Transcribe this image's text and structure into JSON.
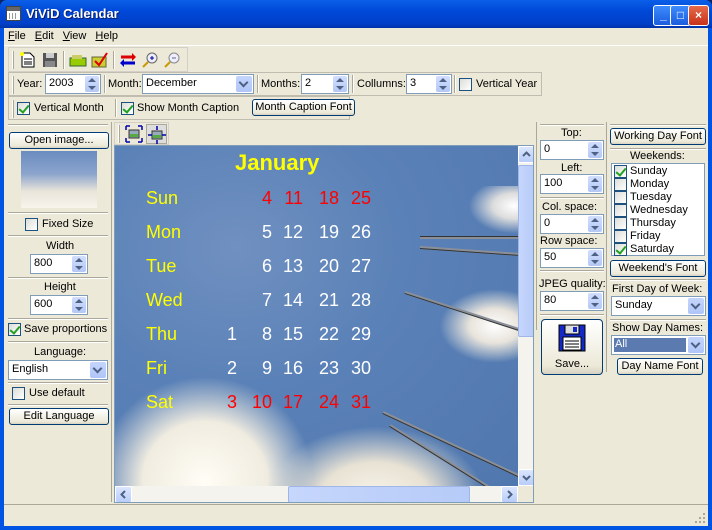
{
  "window": {
    "title": "ViViD Calendar",
    "minimize_label": "_",
    "maximize_label": "□",
    "close_label": "×"
  },
  "menu": [
    {
      "label": "File",
      "accel": "F",
      "rest": "ile"
    },
    {
      "label": "Edit",
      "accel": "E",
      "rest": "dit"
    },
    {
      "label": "View",
      "accel": "V",
      "rest": "iew"
    },
    {
      "label": "Help",
      "accel": "H",
      "rest": "elp"
    }
  ],
  "toolbar": {
    "icons": [
      "new-document-icon",
      "save-icon",
      "open-image-icon",
      "apply-icon",
      "swap-icon",
      "zoom-in-icon",
      "zoom-out-icon"
    ]
  },
  "settings": {
    "year_label": "Year:",
    "year_value": "2003",
    "month_label": "Month:",
    "month_value": "December",
    "months_label": "Months:",
    "months_value": "2",
    "columns_label": "Collumns:",
    "columns_value": "3",
    "vertical_year_label": "Vertical Year",
    "vertical_year_checked": false,
    "vertical_month_label": "Vertical Month",
    "vertical_month_checked": true,
    "show_caption_label": "Show Month Caption",
    "show_caption_checked": true,
    "caption_font_button": "Month Caption Font"
  },
  "left_panel": {
    "open_image_button": "Open image...",
    "fixed_size_label": "Fixed Size",
    "fixed_size_checked": false,
    "width_label": "Width",
    "width_value": "800",
    "height_label": "Height",
    "height_value": "600",
    "save_proportions_label": "Save proportions",
    "save_proportions_checked": true,
    "language_label": "Language:",
    "language_value": "English",
    "use_default_label": "Use default",
    "use_default_checked": false,
    "edit_language_button": "Edit Language"
  },
  "calendar": {
    "title": "January",
    "colors": {
      "title": "#ffff00",
      "day_name": "#ffff00",
      "weekday": "#ffffff",
      "weekend": "#ff0000"
    },
    "rows": [
      {
        "name": "Sun",
        "weekend": true,
        "days": [
          "",
          "4",
          "11",
          "18",
          "25"
        ]
      },
      {
        "name": "Mon",
        "weekend": false,
        "days": [
          "",
          "5",
          "12",
          "19",
          "26"
        ]
      },
      {
        "name": "Tue",
        "weekend": false,
        "days": [
          "",
          "6",
          "13",
          "20",
          "27"
        ]
      },
      {
        "name": "Wed",
        "weekend": false,
        "days": [
          "",
          "7",
          "14",
          "21",
          "28"
        ]
      },
      {
        "name": "Thu",
        "weekend": false,
        "days": [
          "1",
          "8",
          "15",
          "22",
          "29"
        ]
      },
      {
        "name": "Fri",
        "weekend": false,
        "days": [
          "2",
          "9",
          "16",
          "23",
          "30"
        ]
      },
      {
        "name": "Sat",
        "weekend": true,
        "days": [
          "3",
          "10",
          "17",
          "24",
          "31"
        ]
      }
    ]
  },
  "position_panel": {
    "top_label": "Top:",
    "top_value": "0",
    "left_label": "Left:",
    "left_value": "100",
    "col_space_label": "Col. space:",
    "col_space_value": "0",
    "row_space_label": "Row space:",
    "row_space_value": "50",
    "jpeg_quality_label": "JPEG quality:",
    "jpeg_quality_value": "80",
    "save_button": "Save..."
  },
  "font_panel": {
    "working_day_font_button": "Working Day Font",
    "weekends_label": "Weekends:",
    "weekends": [
      {
        "label": "Sunday",
        "checked": true
      },
      {
        "label": "Monday",
        "checked": false
      },
      {
        "label": "Tuesday",
        "checked": false
      },
      {
        "label": "Wednesday",
        "checked": false
      },
      {
        "label": "Thursday",
        "checked": false
      },
      {
        "label": "Friday",
        "checked": false
      },
      {
        "label": "Saturday",
        "checked": true
      }
    ],
    "weekend_font_button": "Weekend's Font",
    "first_day_label": "First Day of Week:",
    "first_day_value": "Sunday",
    "show_day_names_label": "Show Day Names:",
    "show_day_names_value": "All",
    "day_name_font_button": "Day Name Font"
  }
}
